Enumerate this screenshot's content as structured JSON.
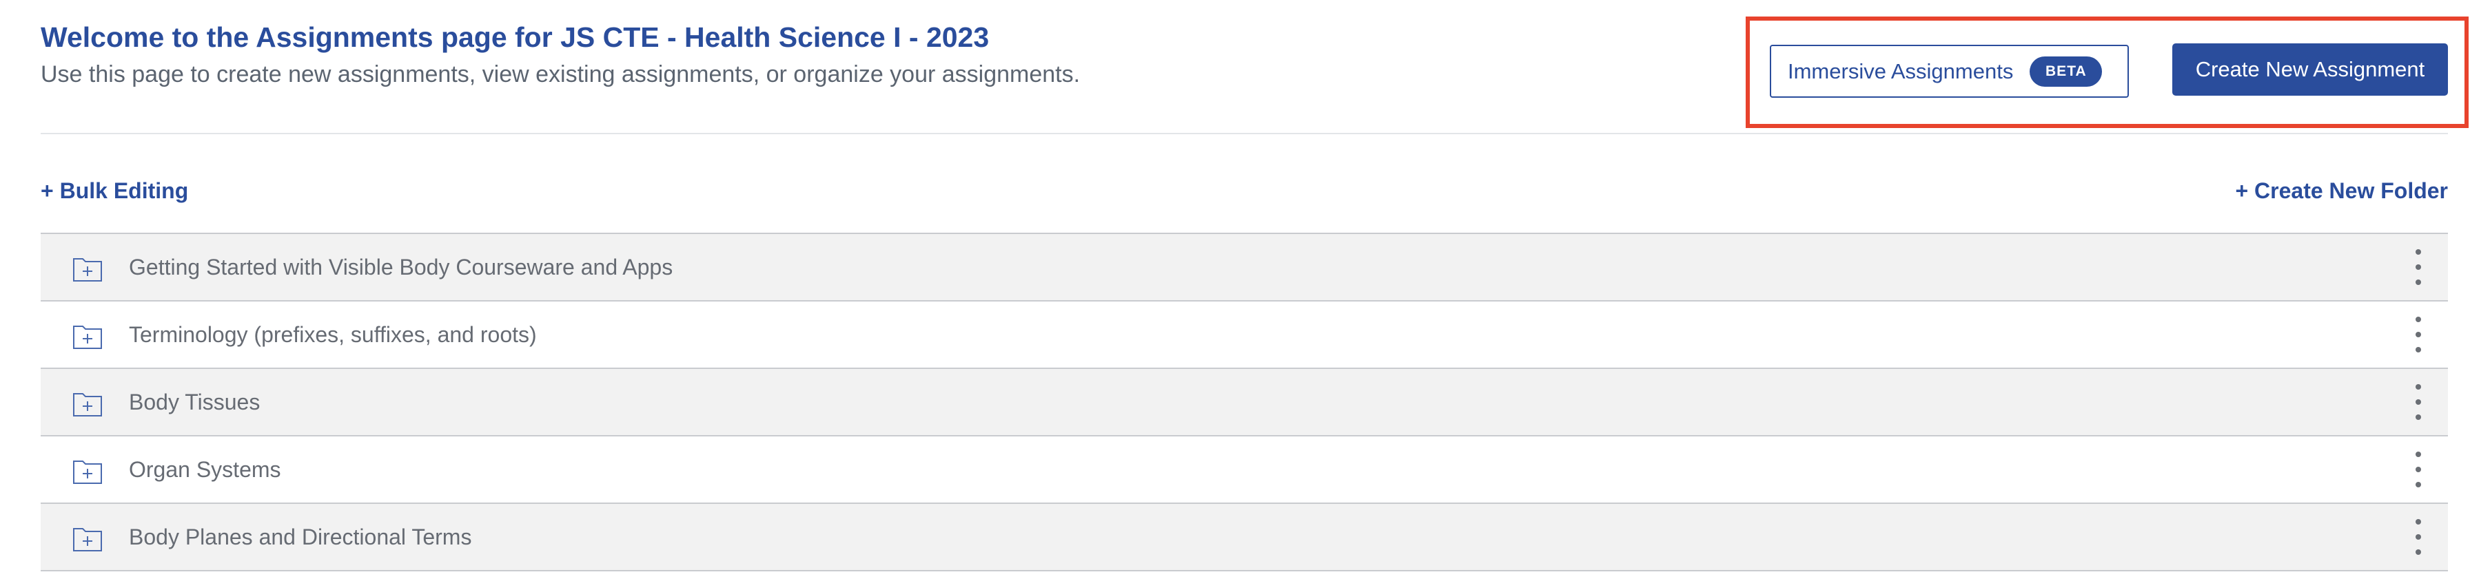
{
  "header": {
    "title": "Welcome to the Assignments page for JS CTE - Health Science I - 2023",
    "subtitle": "Use this page to create new assignments, view existing assignments, or organize your assignments."
  },
  "actions": {
    "immersive_label": "Immersive Assignments",
    "beta_badge": "BETA",
    "create_label": "Create New Assignment"
  },
  "toolbar": {
    "bulk_editing": "+ Bulk Editing",
    "create_folder": "+ Create New Folder"
  },
  "folders": [
    {
      "name": "Getting Started with Visible Body Courseware and Apps"
    },
    {
      "name": "Terminology (prefixes, suffixes, and roots)"
    },
    {
      "name": "Body Tissues"
    },
    {
      "name": "Organ Systems"
    },
    {
      "name": "Body Planes and Directional Terms"
    }
  ],
  "colors": {
    "brand": "#2a4d9c",
    "highlight": "#e8432d",
    "row_shaded": "#f2f2f2",
    "text_muted": "#666b73"
  },
  "icons": {
    "folder": "folder-plus-icon",
    "menu": "kebab-menu-icon"
  }
}
